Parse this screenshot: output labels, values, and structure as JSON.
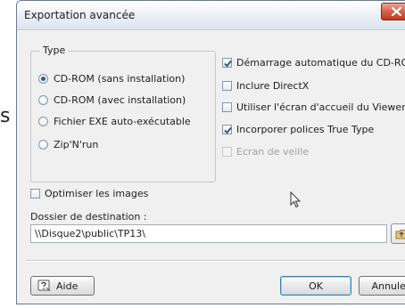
{
  "dialog": {
    "title": "Exportation avancée"
  },
  "page": {
    "outside_fragment": "s"
  },
  "type_group": {
    "legend": "Type",
    "options": [
      {
        "label": "CD-ROM (sans installation)",
        "checked": true
      },
      {
        "label": "CD-ROM (avec installation)",
        "checked": false
      },
      {
        "label": "Fichier EXE auto-exécutable",
        "checked": false
      },
      {
        "label": "Zip'N'run",
        "checked": false
      }
    ]
  },
  "options": [
    {
      "label": "Démarrage automatique du CD-ROM",
      "checked": true,
      "disabled": false
    },
    {
      "label": "Inclure DirectX",
      "checked": false,
      "disabled": false
    },
    {
      "label": "Utiliser l'écran d'accueil du Viewer",
      "checked": false,
      "disabled": false
    },
    {
      "label": "Incorporer polices True Type",
      "checked": true,
      "disabled": false
    },
    {
      "label": "Ecran de veille",
      "checked": false,
      "disabled": true
    }
  ],
  "optimize": {
    "label": "Optimiser les images",
    "checked": false
  },
  "destination": {
    "label": "Dossier de destination :",
    "value": "\\\\Disque2\\public\\TP13\\"
  },
  "buttons": {
    "help": "Aide",
    "ok": "OK",
    "cancel": "Annuler"
  },
  "icons": {
    "close": "close-icon",
    "help": "help-icon",
    "browse": "folder-browse-icon",
    "cursor": "mouse-cursor-icon",
    "check": "checkmark-icon"
  },
  "colors": {
    "dialog_bg": "#f0f0f0",
    "close_button": "#c2391f",
    "accent_radio": "#2e5c9a",
    "default_button_border": "#3c7fb1"
  }
}
